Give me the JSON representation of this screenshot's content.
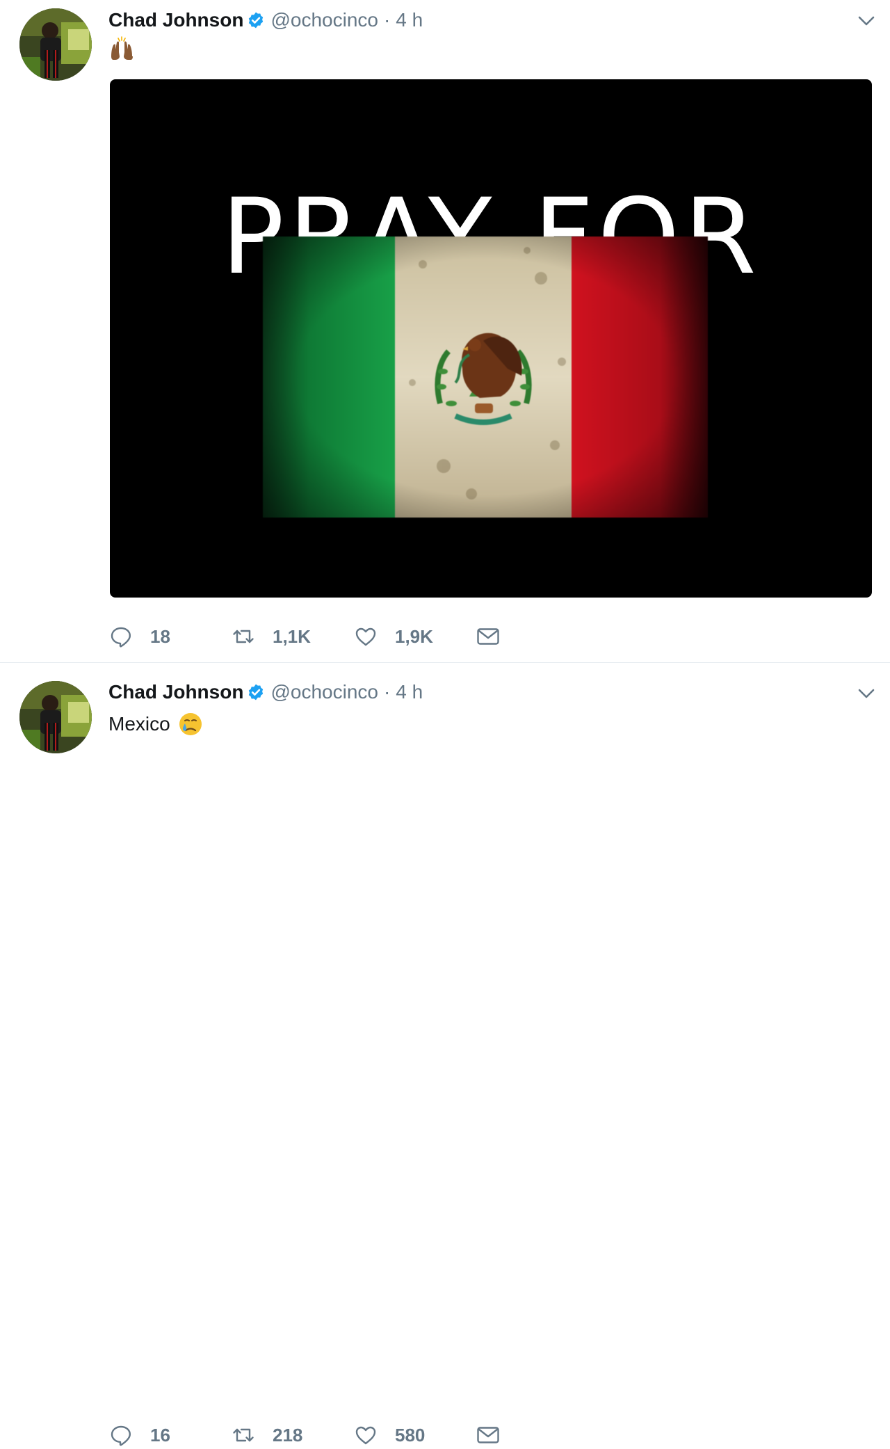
{
  "colors": {
    "text_primary": "#14171a",
    "text_secondary": "#657786",
    "verified_blue": "#1da1f2",
    "divider": "#e6ecf0",
    "flag_green": "#0b8a3a",
    "flag_white": "#d8ccb0",
    "flag_red": "#c8101e"
  },
  "tweets": [
    {
      "author": {
        "display_name": "Chad Johnson",
        "handle": "@ochocinco",
        "verified_icon": "verified-badge-icon",
        "avatar_icon": "avatar"
      },
      "separator": "·",
      "time": "4 h",
      "text": "",
      "emoji": "raising-hands-emoji",
      "media": {
        "headline": "PRAY FOR",
        "image": "mexico-flag"
      },
      "actions": {
        "reply_count": "18",
        "retweet_count": "1,1K",
        "like_count": "1,9K"
      }
    },
    {
      "author": {
        "display_name": "Chad Johnson",
        "handle": "@ochocinco",
        "verified_icon": "verified-badge-icon",
        "avatar_icon": "avatar"
      },
      "separator": "·",
      "time": "4 h",
      "text": "Mexico",
      "emoji": "crying-face-emoji",
      "actions": {
        "reply_count": "16",
        "retweet_count": "218",
        "like_count": "580"
      }
    }
  ]
}
